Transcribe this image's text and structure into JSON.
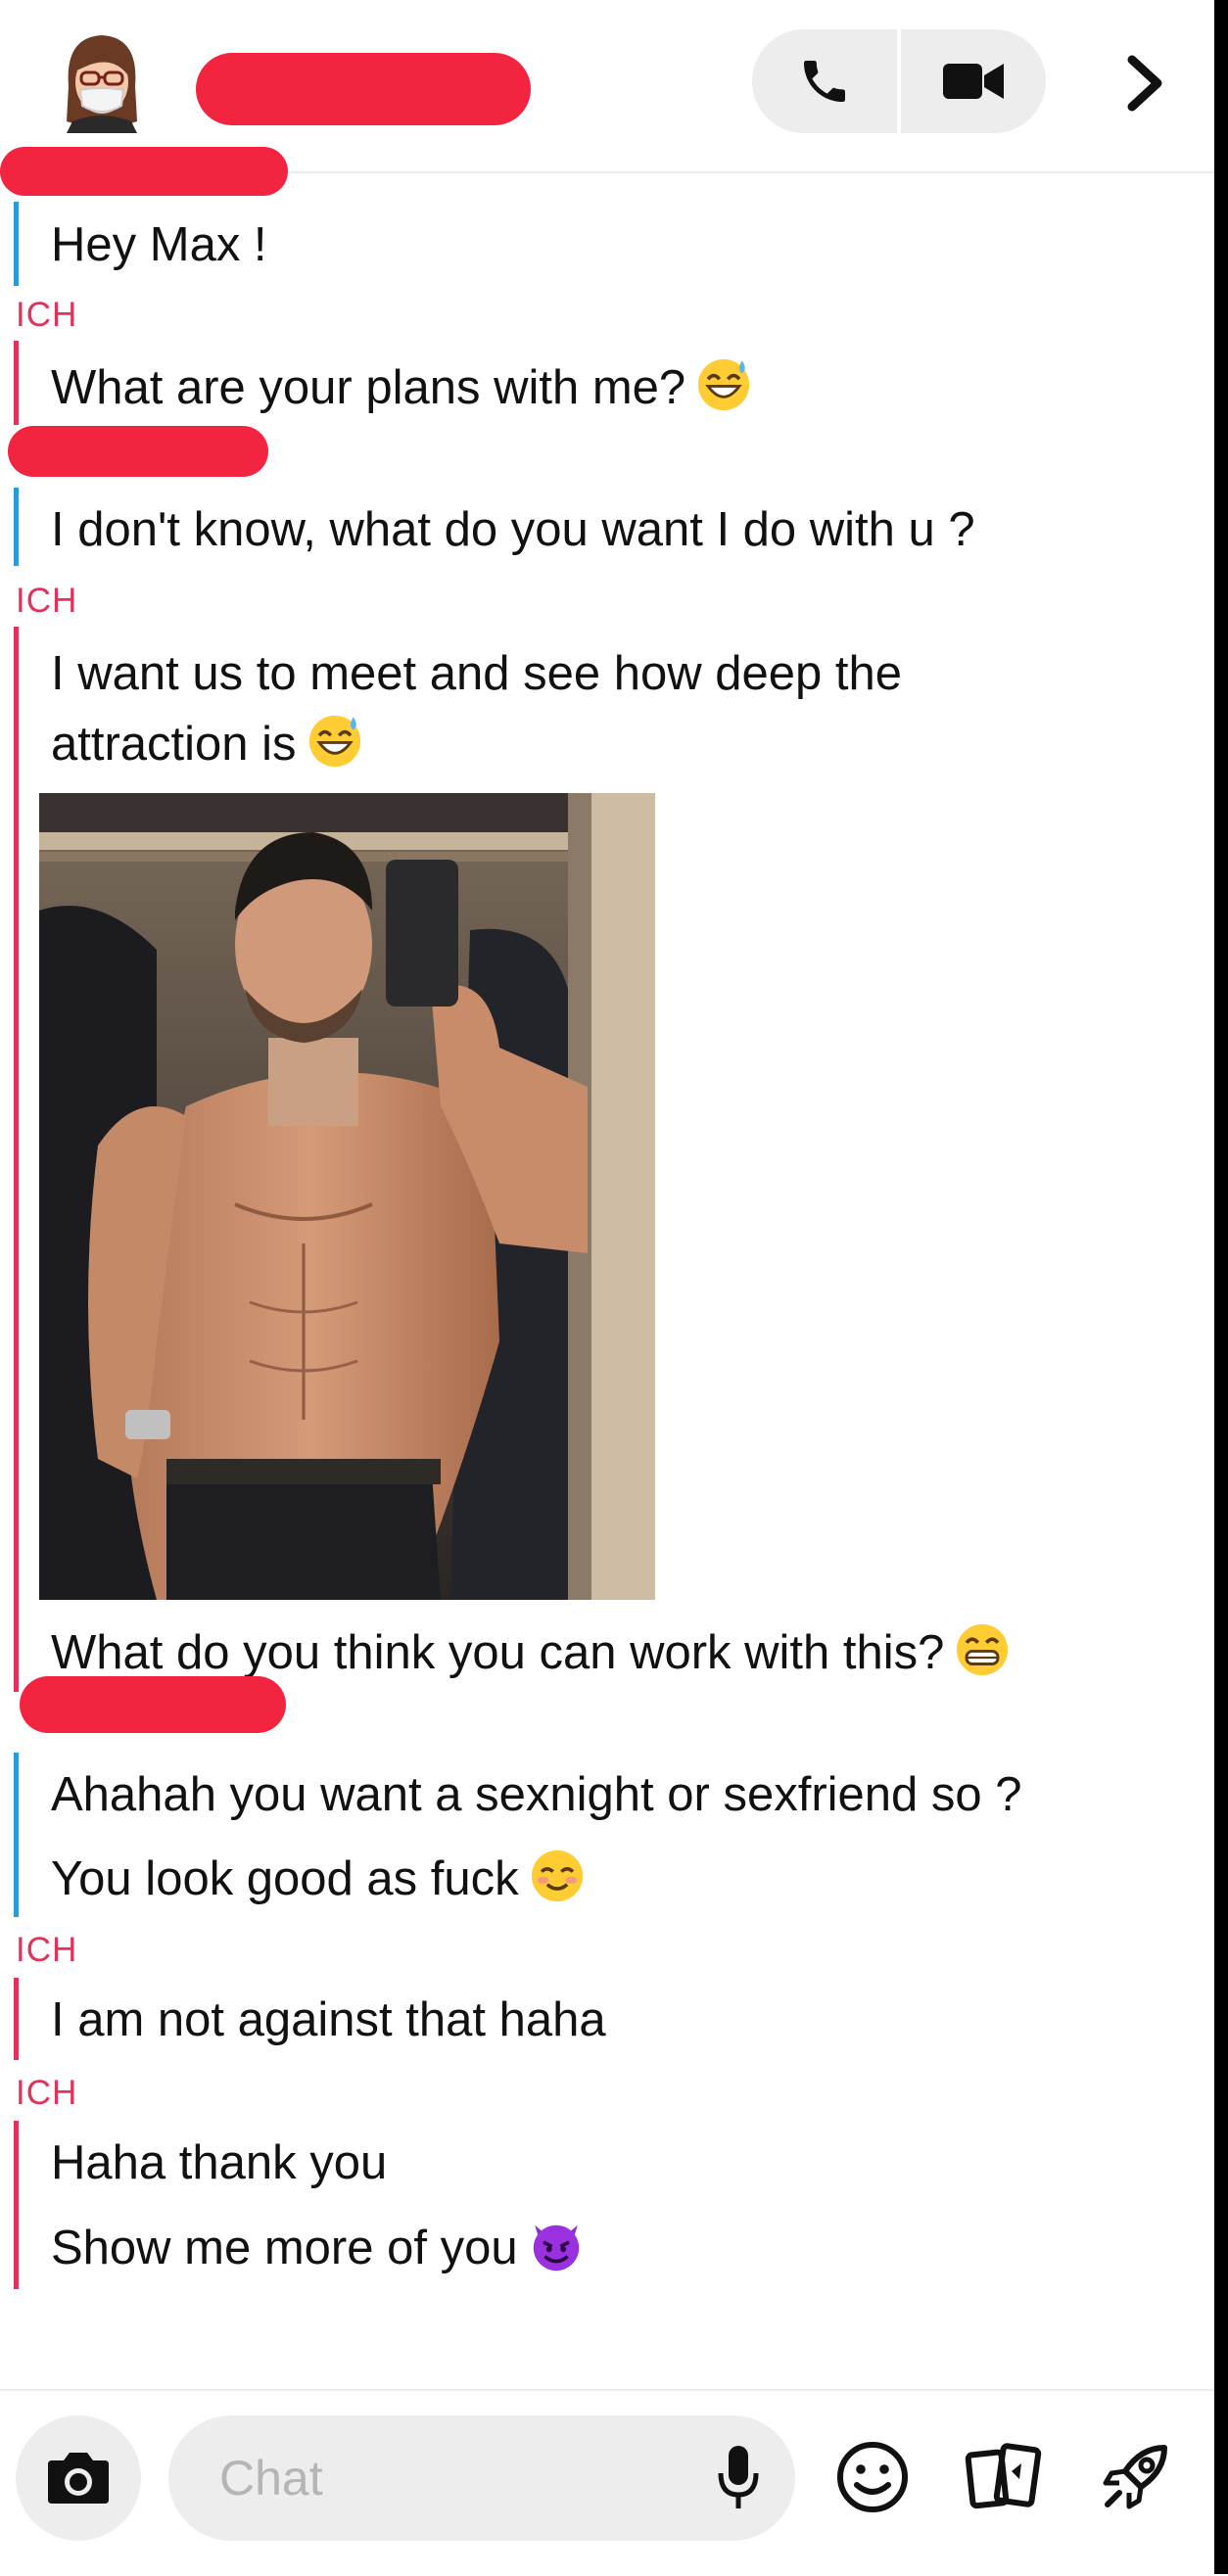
{
  "header": {
    "contact_name": "",
    "icons": [
      "avatar-bitmoji",
      "phone-icon",
      "video-camera-icon",
      "chevron-right-icon"
    ]
  },
  "labels": {
    "me": "ICH"
  },
  "messages": [
    {
      "sender": "them",
      "lines": [
        "Hey Max !"
      ]
    },
    {
      "sender": "me",
      "lines": [
        "What are your plans with me?"
      ],
      "emoji": "sweat-smile-emoji"
    },
    {
      "sender": "them",
      "lines": [
        "I don't know, what do you want I do with u ?"
      ]
    },
    {
      "sender": "me",
      "lines": [
        "I want us to meet and see how deep the",
        "attraction is"
      ],
      "emoji": "sweat-smile-emoji"
    },
    {
      "sender": "me",
      "lines": [
        "What do you think you can work with this?"
      ],
      "emoji": "grin-emoji"
    },
    {
      "sender": "them",
      "lines": [
        "Ahahah you want a sexnight or sexfriend so ?"
      ]
    },
    {
      "sender": "them",
      "lines": [
        "You look good as fuck"
      ],
      "emoji": "smiling-blush-emoji"
    },
    {
      "sender": "me",
      "lines": [
        "I am not against that haha"
      ]
    },
    {
      "sender": "me",
      "lines": [
        "Haha thank you"
      ]
    },
    {
      "sender": "me",
      "lines": [
        "Show me more of you"
      ],
      "emoji": "smiling-devil-emoji"
    }
  ],
  "photo": {
    "description_icon": "shirtless-mirror-selfie-photo"
  },
  "composer": {
    "placeholder": "Chat",
    "icons": [
      "camera-icon",
      "microphone-icon",
      "smiley-icon",
      "cards-icon",
      "rocket-icon"
    ]
  },
  "colors": {
    "me": "#e0325a",
    "them": "#2a9ad9",
    "redaction": "#f2243f",
    "pill_bg": "#ededed"
  }
}
